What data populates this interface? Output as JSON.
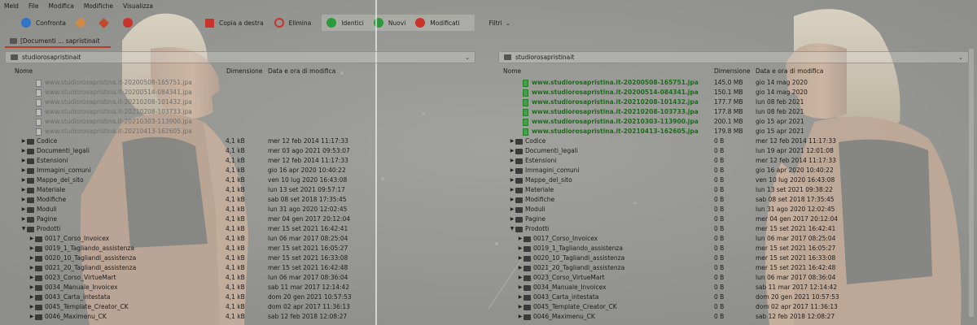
{
  "menu": [
    "Meld",
    "File",
    "Modifica",
    "Modifiche",
    "Visualizza"
  ],
  "toolbar": {
    "compare": "Confronta",
    "copy_right": "Copia a destra",
    "delete": "Elimina",
    "identical": "Identici",
    "new": "Nuovi",
    "modified": "Modificati",
    "filters": "Filtri"
  },
  "tab": {
    "label": "[Documenti ... sapristinait"
  },
  "left": {
    "path": "studiorosapristinait",
    "columns": {
      "name": "Nome",
      "size": "Dimensione",
      "date": "Data e ora di modifica"
    },
    "files": [
      "www.studiorosapristina.it-20200508-165751.jpa",
      "www.studiorosapristina.it-20200514-084341.jpa",
      "www.studiorosapristina.it-20210208-101432.jpa",
      "www.studiorosapristina.it-20210208-103733.jpa",
      "www.studiorosapristina.it-20210303-113900.jpa",
      "www.studiorosapristina.it-20210413-162605.jpa"
    ],
    "folders": [
      {
        "name": "Codice",
        "size": "4,1 kB",
        "date": "mer 12 feb 2014 11:17:33"
      },
      {
        "name": "Documenti_legali",
        "size": "4,1 kB",
        "date": "mer 03 ago 2021 09:53:07"
      },
      {
        "name": "Estensioni",
        "size": "4,1 kB",
        "date": "mer 12 feb 2014 11:17:33"
      },
      {
        "name": "Immagini_comuni",
        "size": "4,1 kB",
        "date": "gio 16 apr 2020 10:40:22"
      },
      {
        "name": "Mappe_del_sito",
        "size": "4,1 kB",
        "date": "ven 10 lug 2020 16:43:08"
      },
      {
        "name": "Materiale",
        "size": "4,1 kB",
        "date": "lun 13 set 2021 09:57:17"
      },
      {
        "name": "Modifiche",
        "size": "4,1 kB",
        "date": "sab 08 set 2018 17:35:45"
      },
      {
        "name": "Moduli",
        "size": "4,1 kB",
        "date": "lun 31 ago 2020 12:02:45"
      },
      {
        "name": "Pagine",
        "size": "4,1 kB",
        "date": "mer 04 gen 2017 20:12:04"
      },
      {
        "name": "Prodotti",
        "size": "4,1 kB",
        "date": "mer 15 set 2021 16:42:41"
      }
    ],
    "subfolders": [
      {
        "name": "0017_Corso_Invoicex",
        "size": "4,1 kB",
        "date": "lun 06 mar 2017 08:25:04"
      },
      {
        "name": "0019_1_Tagliando_assistenza",
        "size": "4,1 kB",
        "date": "mer 15 set 2021 16:05:27"
      },
      {
        "name": "0020_10_Tagliandi_assistenza",
        "size": "4,1 kB",
        "date": "mer 15 set 2021 16:33:08"
      },
      {
        "name": "0021_20_Tagliandi_assistenza",
        "size": "4,1 kB",
        "date": "mer 15 set 2021 16:42:48"
      },
      {
        "name": "0023_Corso_VirtueMart",
        "size": "4,1 kB",
        "date": "lun 06 mar 2017 08:36:04"
      },
      {
        "name": "0034_Manuale_Invoicex",
        "size": "4,1 kB",
        "date": "sab 11 mar 2017 12:14:42"
      },
      {
        "name": "0043_Carta_intestata",
        "size": "4,1 kB",
        "date": "dom 20 gen 2021 10:57:53"
      },
      {
        "name": "0045_Template_Creator_CK",
        "size": "4,1 kB",
        "date": "dom 02 apr 2017 11:36:13"
      },
      {
        "name": "0046_Maximenu_CK",
        "size": "4,1 kB",
        "date": "sab 12 feb 2018 12:08:27"
      }
    ]
  },
  "right": {
    "path": "studiorosapristinait",
    "columns": {
      "name": "Nome",
      "size": "Dimensione",
      "date": "Data e ora di modifica"
    },
    "files": [
      {
        "name": "www.studiorosapristina.it-20200508-165751.jpa",
        "size": "145.0 MB",
        "date": "gio 14 mag 2020"
      },
      {
        "name": "www.studiorosapristina.it-20200514-084341.jpa",
        "size": "150.1 MB",
        "date": "gio 14 mag 2020"
      },
      {
        "name": "www.studiorosapristina.it-20210208-101432.jpa",
        "size": "177.7 MB",
        "date": "lun 08 feb 2021"
      },
      {
        "name": "www.studiorosapristina.it-20210208-103733.jpa",
        "size": "177.8 MB",
        "date": "lun 08 feb 2021"
      },
      {
        "name": "www.studiorosapristina.it-20210303-113900.jpa",
        "size": "200.1 MB",
        "date": "gio 15 apr 2021"
      },
      {
        "name": "www.studiorosapristina.it-20210413-162605.jpa",
        "size": "179.8 MB",
        "date": "gio 15 apr 2021"
      }
    ],
    "folders": [
      {
        "name": "Codice",
        "size": "0 B",
        "date": "mer 12 feb 2014 11:17:33"
      },
      {
        "name": "Documenti_legali",
        "size": "0 B",
        "date": "lun 19 apr 2021 12:01:08"
      },
      {
        "name": "Estensioni",
        "size": "0 B",
        "date": "mer 12 feb 2014 11:17:33"
      },
      {
        "name": "Immagini_comuni",
        "size": "0 B",
        "date": "gio 16 apr 2020 10:40:22"
      },
      {
        "name": "Mappe_del_sito",
        "size": "0 B",
        "date": "ven 10 lug 2020 16:43:08"
      },
      {
        "name": "Materiale",
        "size": "0 B",
        "date": "lun 13 set 2021 09:38:22"
      },
      {
        "name": "Modifiche",
        "size": "0 B",
        "date": "sab 08 set 2018 17:35:45"
      },
      {
        "name": "Moduli",
        "size": "0 B",
        "date": "lun 31 ago 2020 12:02:45"
      },
      {
        "name": "Pagine",
        "size": "0 B",
        "date": "mer 04 gen 2017 20:12:04"
      },
      {
        "name": "Prodotti",
        "size": "0 B",
        "date": "mer 15 set 2021 16:42:41"
      }
    ],
    "subfolders": [
      {
        "name": "0017_Corso_Invoicex",
        "size": "0 B",
        "date": "lun 06 mar 2017 08:25:04"
      },
      {
        "name": "0019_1_Tagliando_assistenza",
        "size": "0 B",
        "date": "mer 15 set 2021 16:05:27"
      },
      {
        "name": "0020_10_Tagliandi_assistenza",
        "size": "0 B",
        "date": "mer 15 set 2021 16:33:08"
      },
      {
        "name": "0021_20_Tagliandi_assistenza",
        "size": "0 B",
        "date": "mer 15 set 2021 16:42:48"
      },
      {
        "name": "0023_Corso_VirtueMart",
        "size": "0 B",
        "date": "lun 06 mar 2017 08:36:04"
      },
      {
        "name": "0034_Manuale_Invoicex",
        "size": "0 B",
        "date": "sab 11 mar 2017 12:14:42"
      },
      {
        "name": "0043_Carta_intestata",
        "size": "0 B",
        "date": "dom 20 gen 2021 10:57:53"
      },
      {
        "name": "0045_Template_Creator_CK",
        "size": "0 B",
        "date": "dom 02 apr 2017 11:36:13"
      },
      {
        "name": "0046_Maximenu_CK",
        "size": "0 B",
        "date": "sab 12 feb 2018 12:08:27"
      }
    ]
  },
  "colors": {
    "accent_tab": "#b93a2a",
    "identical_green": "#2c9a3c",
    "new_file_text": "#1d6b1d"
  }
}
